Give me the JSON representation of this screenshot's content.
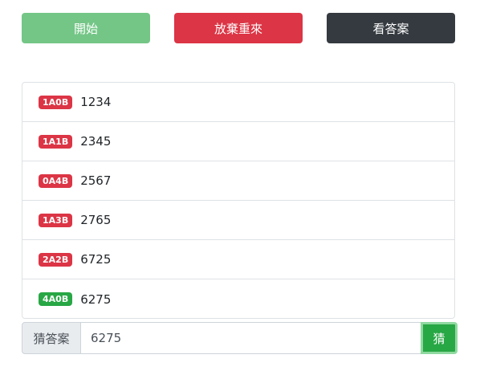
{
  "toolbar": {
    "start_label": "開始",
    "reset_label": "放棄重來",
    "answer_label": "看答案"
  },
  "history": [
    {
      "result": "1A0B",
      "guess": "1234",
      "status": "wrong"
    },
    {
      "result": "1A1B",
      "guess": "2345",
      "status": "wrong"
    },
    {
      "result": "0A4B",
      "guess": "2567",
      "status": "wrong"
    },
    {
      "result": "1A3B",
      "guess": "2765",
      "status": "wrong"
    },
    {
      "result": "2A2B",
      "guess": "6725",
      "status": "wrong"
    },
    {
      "result": "4A0B",
      "guess": "6275",
      "status": "correct"
    }
  ],
  "colors": {
    "wrong": "#dc3545",
    "correct": "#28a745"
  },
  "guess_form": {
    "prepend_label": "猜答案",
    "input_value": "6275",
    "submit_label": "猜"
  }
}
